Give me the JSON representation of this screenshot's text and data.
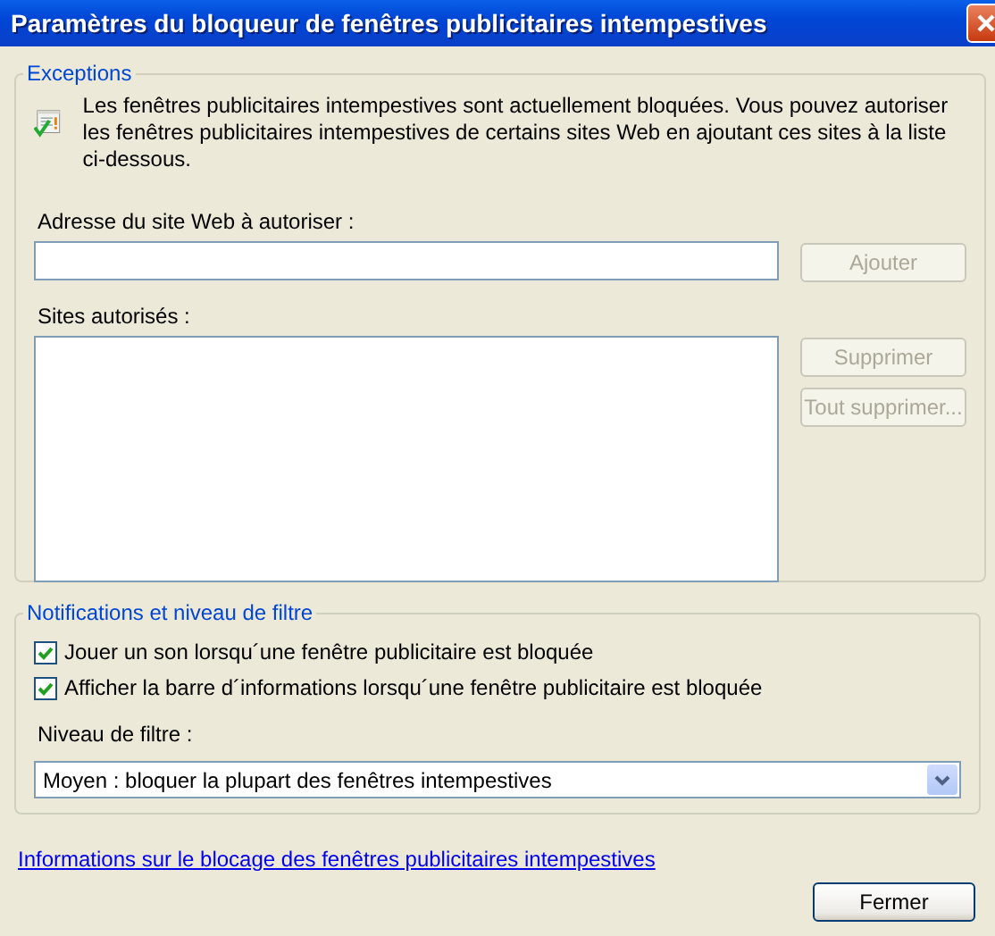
{
  "window": {
    "title": "Paramètres du bloqueur de fenêtres publicitaires intempestives"
  },
  "exceptions": {
    "legend": "Exceptions",
    "message": "Les fenêtres publicitaires intempestives sont actuellement bloquées.  Vous pouvez autoriser les fenêtres publicitaires intempestives de certains sites Web en ajoutant ces sites à la liste ci-dessous.",
    "address_label": "Adresse du site Web à autoriser :",
    "sites_label": "Sites autorisés :",
    "buttons": [
      {
        "label": "Ajouter",
        "disabled": true
      },
      {
        "label": "Supprimer",
        "disabled": true
      },
      {
        "label": "Tout supprimer...",
        "disabled": true
      }
    ]
  },
  "notifications": {
    "legend": "Notifications et niveau de filtre",
    "options": [
      {
        "label": "Jouer un son lorsqu´une fenêtre publicitaire est bloquée",
        "checked": true
      },
      {
        "label": "Afficher la barre d´informations lorsqu´une fenêtre publicitaire est bloquée",
        "checked": true
      }
    ],
    "filter_label": "Niveau de filtre :",
    "filter_value": "Moyen : bloquer la plupart des fenêtres intempestives"
  },
  "link": "Informations sur le blocage des fenêtres publicitaires intempestives",
  "close_button": "Fermer"
}
